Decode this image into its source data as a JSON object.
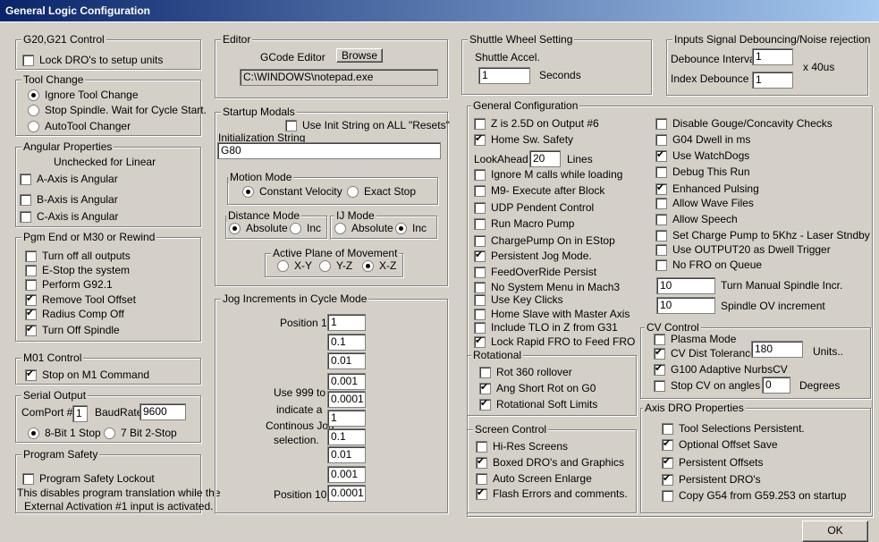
{
  "window": {
    "title": "General Logic Configuration"
  },
  "g20": {
    "title": "G20,G21 Control",
    "lock_dro": {
      "label": "Lock DRO's to setup units",
      "checked": false
    }
  },
  "tool_change": {
    "title": "Tool Change",
    "ignore": "Ignore Tool Change",
    "stop": "Stop Spindle. Wait for Cycle Start.",
    "auto": "AutoTool Changer",
    "selected": "ignore"
  },
  "angular": {
    "title": "Angular Properties",
    "note": "Unchecked for Linear",
    "a": "A-Axis is Angular",
    "b": "B-Axis is Angular",
    "c": "C-Axis is Angular"
  },
  "pgm_end": {
    "title": "Pgm End or M30 or Rewind",
    "turn_off_outputs": "Turn off all outputs",
    "estop": "E-Stop the system",
    "g92": "Perform G92.1",
    "remove_tool": "Remove Tool Offset",
    "radius_comp": "Radius Comp Off",
    "turn_off_spindle": "Turn Off Spindle"
  },
  "m01": {
    "title": "M01 Control",
    "stop": "Stop on M1 Command"
  },
  "serial": {
    "title": "Serial Output",
    "comport_label": "ComPort #",
    "comport": "1",
    "baud_label": "BaudRate",
    "baud": "9600",
    "opt8": "8-Bit 1 Stop",
    "opt7": "7 Bit 2-Stop"
  },
  "safety": {
    "title": "Program Safety",
    "lockout": "Program Safety Lockout",
    "note1": "This disables program translation while the",
    "note2": "External Activation #1 input is activated."
  },
  "editor": {
    "title": "Editor",
    "label": "GCode Editor",
    "browse": "Browse",
    "path": "C:\\WINDOWS\\notepad.exe"
  },
  "startup": {
    "title": "Startup Modals",
    "use_init": "Use Init String on ALL  \"Resets\"",
    "init_label": "Initialization String",
    "init_value": "G80",
    "motion": {
      "title": "Motion Mode",
      "cv": "Constant Velocity",
      "es": "Exact Stop"
    },
    "distance": {
      "title": "Distance Mode",
      "abs": "Absolute",
      "inc": "Inc"
    },
    "ij": {
      "title": "IJ Mode",
      "abs": "Absolute",
      "inc": "Inc"
    },
    "plane": {
      "title": "Active Plane of Movement",
      "xy": "X-Y",
      "yz": "Y-Z",
      "xz": "X-Z"
    }
  },
  "jog": {
    "title": "Jog Increments in Cycle Mode",
    "pos1": "Position 1",
    "pos10": "Position 10",
    "note": [
      "Use 999 to",
      "indicate a",
      "Continous Jog",
      "selection."
    ],
    "values": [
      "1",
      "0.1",
      "0.01",
      "0.001",
      "0.0001",
      "1",
      "0.1",
      "0.01",
      "0.001",
      "0.0001"
    ]
  },
  "shuttle": {
    "title": "Shuttle Wheel Setting",
    "accel_label": "Shuttle Accel.",
    "accel": "1",
    "seconds": "Seconds"
  },
  "debounce": {
    "title": "Inputs Signal Debouncing/Noise rejection",
    "interval_label": "Debounce Interval",
    "interval": "1",
    "index_label": "Index Debounce",
    "index": "1",
    "unit": "x 40us"
  },
  "general": {
    "title": "General Configuration",
    "left": [
      {
        "label": "Z is 2.5D on Output #6",
        "checked": false
      },
      {
        "label": "Home Sw. Safety",
        "checked": true
      },
      {
        "label": "Ignore M calls while loading",
        "checked": false
      },
      {
        "label": "M9- Execute after Block",
        "checked": false
      },
      {
        "label": "UDP Pendent Control",
        "checked": false
      },
      {
        "label": "Run Macro Pump",
        "checked": false
      },
      {
        "label": "ChargePump On in EStop",
        "checked": false
      },
      {
        "label": "Persistent Jog Mode.",
        "checked": true
      },
      {
        "label": "FeedOverRide Persist",
        "checked": false
      },
      {
        "label": "No System Menu in Mach3",
        "checked": false
      },
      {
        "label": "Use Key Clicks",
        "checked": false
      },
      {
        "label": "Home Slave with Master Axis",
        "checked": false
      },
      {
        "label": "Include TLO in Z from G31",
        "checked": false
      },
      {
        "label": "Lock Rapid FRO to Feed FRO",
        "checked": true
      }
    ],
    "lookahead_label": "LookAhead",
    "lookahead": "20",
    "lines": "Lines",
    "right": [
      {
        "label": "Disable Gouge/Concavity Checks",
        "checked": false
      },
      {
        "label": "G04 Dwell in ms",
        "checked": false
      },
      {
        "label": "Use WatchDogs",
        "checked": true
      },
      {
        "label": "Debug This Run",
        "checked": false
      },
      {
        "label": "Enhanced Pulsing",
        "checked": true
      },
      {
        "label": "Allow Wave Files",
        "checked": false
      },
      {
        "label": "Allow Speech",
        "checked": false
      },
      {
        "label": "Set Charge Pump to 5Khz  - Laser Stndby",
        "checked": false
      },
      {
        "label": "Use OUTPUT20 as Dwell Trigger",
        "checked": false
      },
      {
        "label": "No FRO on Queue",
        "checked": false
      }
    ],
    "spindle_incr": "10",
    "spindle_incr_label": "Turn Manual Spindle Incr.",
    "spindle_ov": "10",
    "spindle_ov_label": "Spindle OV increment"
  },
  "rotational": {
    "title": "Rotational",
    "rot360": "Rot 360 rollover",
    "short": "Ang Short Rot on G0",
    "soft": "Rotational Soft Limits"
  },
  "screen": {
    "title": "Screen Control",
    "hires": "Hi-Res Screens",
    "boxed": "Boxed DRO's and Graphics",
    "auto": "Auto Screen Enlarge",
    "flash": "Flash Errors and comments."
  },
  "cv": {
    "title": "CV Control",
    "plasma": "Plasma Mode",
    "dist": "CV Dist Tolerance",
    "dist_value": "180",
    "units": "Units..",
    "g100": "G100 Adaptive NurbsCV",
    "stop": "Stop CV on angles >",
    "angle": "0",
    "degrees": "Degrees"
  },
  "axis_dro": {
    "title": "Axis DRO Properties",
    "tool_sel": "Tool Selections Persistent.",
    "offset_save": "Optional Offset Save",
    "pers_offsets": "Persistent Offsets",
    "pers_dros": "Persistent DRO's",
    "copy_g54": "Copy G54 from G59.253 on startup"
  },
  "ok": "OK"
}
